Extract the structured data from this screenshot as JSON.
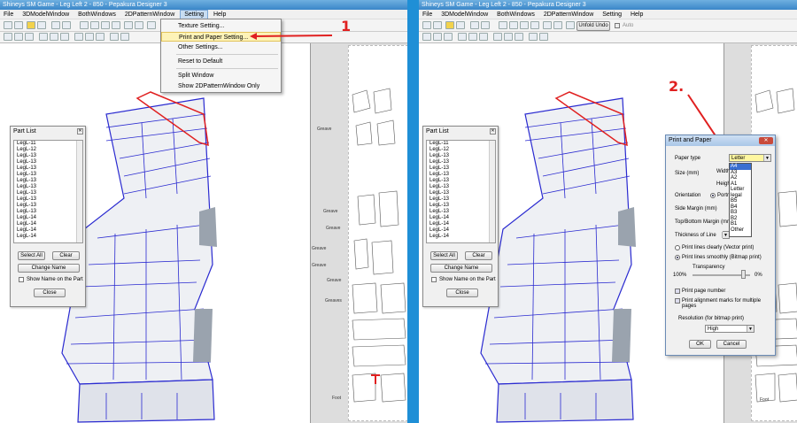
{
  "left": {
    "window_title": "Shineys SM Game - Leg Left 2 - 850 - Pepakura Designer 3",
    "menu": [
      "File",
      "3DModelWindow",
      "BothWindows",
      "2DPatternWindow",
      "Setting",
      "Help"
    ],
    "setting_menu": [
      "Texture Setting...",
      "Print and Paper Setting...",
      "Other Settings...",
      "Reset to Default",
      "Split Window",
      "Show 2DPatternWindow Only"
    ],
    "annotation": "1",
    "part_list": {
      "title": "Part List",
      "items": [
        "LegL-11",
        "LegL-12",
        "LegL-13",
        "LegL-13",
        "LegL-13",
        "LegL-13",
        "LegL-13",
        "LegL-13",
        "LegL-13",
        "LegL-13",
        "LegL-13",
        "LegL-13",
        "LegL-14",
        "LegL-14",
        "LegL-14",
        "LegL-14"
      ],
      "select_all": "Select All",
      "clear": "Clear",
      "change_name": "Change Name",
      "show_name": "Show Name on the Part",
      "close": "Close"
    },
    "pattern_labels": [
      "Greave",
      "Greave",
      "Greave",
      "Greave",
      "Greave",
      "Greave",
      "Greaves",
      "Foot"
    ]
  },
  "right": {
    "window_title": "Shineys SM Game - Leg Left 2 - 850 - Pepakura Designer 3",
    "menu": [
      "File",
      "3DModelWindow",
      "BothWindows",
      "2DPatternWindow",
      "Setting",
      "Help"
    ],
    "unfold_undo": "Unfold Undo",
    "auto": "Auto",
    "annotation": "2.",
    "part_list": {
      "title": "Part List",
      "items": [
        "LegL-11",
        "LegL-12",
        "LegL-13",
        "LegL-13",
        "LegL-13",
        "LegL-13",
        "LegL-13",
        "LegL-13",
        "LegL-13",
        "LegL-13",
        "LegL-13",
        "LegL-13",
        "LegL-14",
        "LegL-14",
        "LegL-14",
        "LegL-14"
      ],
      "select_all": "Select All",
      "clear": "Clear",
      "change_name": "Change Name",
      "show_name": "Show Name on the Part",
      "close": "Close"
    },
    "dialog": {
      "title": "Print and Paper",
      "paper_type_label": "Paper type",
      "paper_type_value": "Letter",
      "paper_options": [
        "A4",
        "A3",
        "A2",
        "A1",
        "Letter",
        "legal",
        "B5",
        "B4",
        "B3",
        "B2",
        "B1",
        "Other"
      ],
      "size_label": "Size (mm)",
      "width_label": "Width",
      "height_label": "Height",
      "orientation_label": "Orientation",
      "orientation_value": "Portrait",
      "side_margin_label": "Side Margin (mm)",
      "topbottom_margin_label": "Top/Bottom Margin (mm)",
      "thickness_label": "Thickness of Line",
      "print_clearly": "Print lines clearly (Vector print)",
      "print_smoothly": "Print lines smoothly (Bitmap print)",
      "transparency_label": "Transparency",
      "transparency_min": "100%",
      "transparency_max": "0%",
      "transparency_value": 0.92,
      "print_page_number": "Print page number",
      "print_alignment": "Print alignment marks for multiple pages",
      "resolution_label": "Resolution (for bitmap print)",
      "resolution_value": "High",
      "ok": "OK",
      "cancel": "Cancel"
    },
    "pattern_labels": [
      "Foot"
    ]
  },
  "colors": {
    "divider": "#1f8fd6",
    "annotation": "#e02020",
    "model_edge": "#2a2ad0",
    "highlight": "#fdf3b8"
  }
}
